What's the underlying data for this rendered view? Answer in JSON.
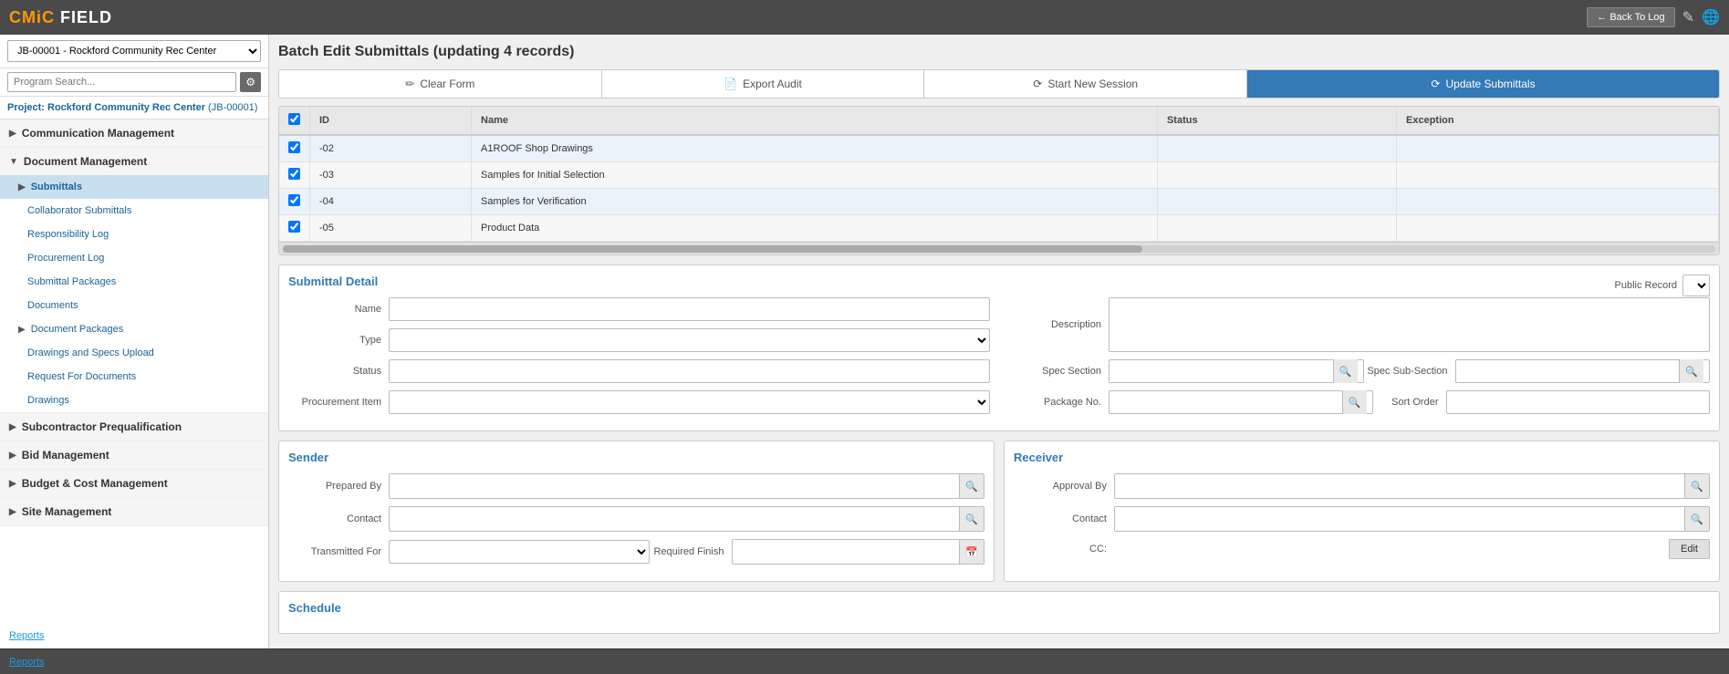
{
  "topBar": {
    "logo": "CMiC FIELD",
    "backToLog": "← Back To Log"
  },
  "sidebar": {
    "projectSelector": "JB-00001 - Rockford Community Rec Center",
    "searchPlaceholder": "Program Search...",
    "projectLabel": "Project: Rockford Community Rec Center",
    "projectCode": "(JB-00001)",
    "sections": [
      {
        "label": "Communication Management",
        "items": []
      },
      {
        "label": "Document Management",
        "items": [
          {
            "label": "Submittals",
            "active": true,
            "sub": false
          },
          {
            "label": "Collaborator Submittals",
            "active": false,
            "sub": true
          },
          {
            "label": "Responsibility Log",
            "active": false,
            "sub": true
          },
          {
            "label": "Procurement Log",
            "active": false,
            "sub": true
          },
          {
            "label": "Submittal Packages",
            "active": false,
            "sub": true
          },
          {
            "label": "Documents",
            "active": false,
            "sub": true
          },
          {
            "label": "Document Packages",
            "active": false,
            "sub": false
          },
          {
            "label": "Drawings and Specs Upload",
            "active": false,
            "sub": true
          },
          {
            "label": "Request For Documents",
            "active": false,
            "sub": true
          },
          {
            "label": "Drawings",
            "active": false,
            "sub": true
          }
        ]
      },
      {
        "label": "Subcontractor Prequalification",
        "items": []
      },
      {
        "label": "Bid Management",
        "items": []
      },
      {
        "label": "Budget & Cost Management",
        "items": []
      },
      {
        "label": "Site Management",
        "items": []
      }
    ],
    "reportsLabel": "Reports"
  },
  "content": {
    "pageTitle": "Batch Edit Submittals (updating 4 records)",
    "toolbar": {
      "clearForm": "Clear Form",
      "exportAudit": "Export Audit",
      "startNewSession": "Start New Session",
      "updateSubmittals": "Update Submittals"
    },
    "table": {
      "columns": [
        "ID",
        "Name",
        "Status",
        "Exception"
      ],
      "rows": [
        {
          "id": "-02",
          "name": "A1ROOF Shop Drawings",
          "status": "",
          "exception": "",
          "checked": true
        },
        {
          "id": "-03",
          "name": "Samples for Initial Selection",
          "status": "",
          "exception": "",
          "checked": true
        },
        {
          "id": "-04",
          "name": "Samples for Verification",
          "status": "",
          "exception": "",
          "checked": true
        },
        {
          "id": "-05",
          "name": "Product Data",
          "status": "",
          "exception": "",
          "checked": true
        }
      ]
    },
    "submittalDetail": {
      "sectionTitle": "Submittal Detail",
      "publicRecordLabel": "Public Record",
      "fields": {
        "name": "",
        "type": "",
        "status": "",
        "procurementItem": "",
        "description": "",
        "specSection": "",
        "specSubSection": "",
        "packageNo": "",
        "sortOrder": ""
      }
    },
    "sender": {
      "title": "Sender",
      "preparedBy": "",
      "contact": "",
      "transmittedFor": "",
      "requiredFinish": ""
    },
    "receiver": {
      "title": "Receiver",
      "approvalBy": "",
      "contact": "",
      "cc": "",
      "editLabel": "Edit"
    },
    "schedule": {
      "title": "Schedule"
    }
  }
}
